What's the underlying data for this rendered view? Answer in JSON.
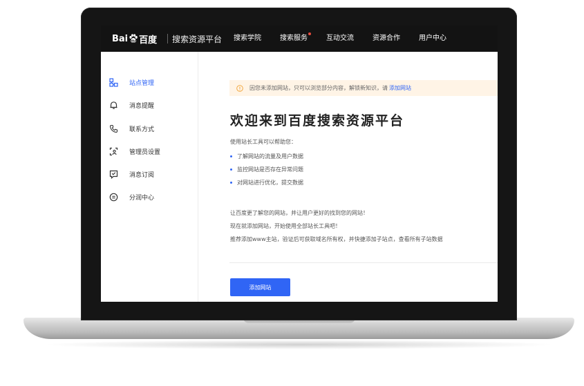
{
  "brand": {
    "logo_bai": "Bai",
    "logo_baidu": "百度",
    "product": "搜索资源平台"
  },
  "nav": {
    "items": [
      "搜索学院",
      "搜索服务",
      "互动交流",
      "资源合作",
      "用户中心"
    ]
  },
  "sidebar": {
    "items": [
      {
        "label": "站点管理",
        "icon": "site-structure-icon"
      },
      {
        "label": "消息提醒",
        "icon": "bell-icon"
      },
      {
        "label": "联系方式",
        "icon": "phone-icon"
      },
      {
        "label": "管理员设置",
        "icon": "admin-icon"
      },
      {
        "label": "消息订阅",
        "icon": "subscribe-icon"
      },
      {
        "label": "分润中心",
        "icon": "revenue-icon"
      }
    ]
  },
  "notice": {
    "text": "因您未添加网站，只可以浏览部分内容，解锁新知识，请",
    "link": "添加网站"
  },
  "main": {
    "title": "欢迎来到百度搜索资源平台",
    "intro": "使用站长工具可以帮助您：",
    "bullets": [
      "了解网站的流量及用户数据",
      "监控网站是否存在异常问题",
      "对网站进行优化，提交数据"
    ],
    "para1": "让百度更了解您的网站，并让用户更好的找到您的网站！",
    "para2": "现在就添加网站，开始使用全部站长工具吧！",
    "para3": "推荐添加www主站，验证后可获取域名所有权，并快捷添加子站点，查看所有子站数据",
    "button": "添加网站"
  },
  "colors": {
    "accent": "#3065f5",
    "topbar": "#131313",
    "notice_bg": "#fff4e6",
    "notice_icon": "#f0a030",
    "nav_dot": "#e84c3d"
  }
}
